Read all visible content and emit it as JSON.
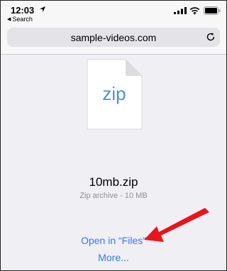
{
  "status_bar": {
    "time": "12:03",
    "back_app": "Search",
    "icons": [
      "location-arrow-icon",
      "signal-icon",
      "wifi-icon",
      "battery-icon"
    ]
  },
  "address_bar": {
    "url": "sample-videos.com",
    "reload_icon": "reload-icon"
  },
  "file": {
    "icon": "document-icon",
    "extension": "zip",
    "name": "10mb.zip",
    "meta": "Zip archive - 10 MB"
  },
  "actions": {
    "open_in_files": "Open in “Files”",
    "more": "More..."
  },
  "annotation": {
    "icon": "red-arrow-icon",
    "color": "#e8141b"
  },
  "colors": {
    "link": "#3478f6",
    "doc_extension": "#4a90e2",
    "background": "#efeff4"
  }
}
